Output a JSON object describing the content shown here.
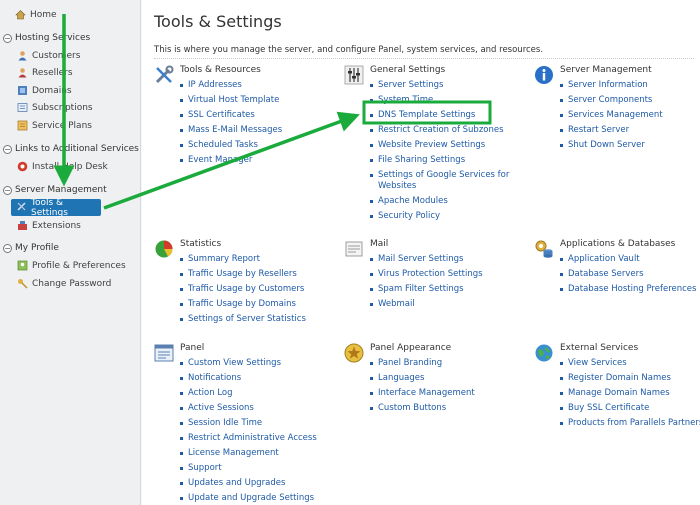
{
  "sidebar": {
    "home": "Home",
    "hosting_services": {
      "title": "Hosting Services",
      "items": [
        "Customers",
        "Resellers",
        "Domains",
        "Subscriptions",
        "Service Plans"
      ]
    },
    "links": {
      "title": "Links to Additional Services",
      "items": [
        "Install Help Desk"
      ]
    },
    "server_management": {
      "title": "Server Management",
      "items": [
        "Tools & Settings",
        "Extensions"
      ]
    },
    "my_profile": {
      "title": "My Profile",
      "items": [
        "Profile & Preferences",
        "Change Password"
      ]
    }
  },
  "main": {
    "title": "Tools & Settings",
    "description": "This is where you manage the server, and configure Panel, system services, and resources.",
    "groups": {
      "tools": {
        "title": "Tools & Resources",
        "items": [
          "IP Addresses",
          "Virtual Host Template",
          "SSL Certificates",
          "Mass E-Mail Messages",
          "Scheduled Tasks",
          "Event Manager"
        ]
      },
      "general": {
        "title": "General Settings",
        "items": [
          "Server Settings",
          "System Time",
          "DNS Template Settings",
          "Restrict Creation of Subzones",
          "Website Preview Settings",
          "File Sharing Settings",
          "Settings of Google Services for Websites",
          "Apache Modules",
          "Security Policy"
        ]
      },
      "server": {
        "title": "Server Management",
        "items": [
          "Server Information",
          "Server Components",
          "Services Management",
          "Restart Server",
          "Shut Down Server"
        ]
      },
      "statistics": {
        "title": "Statistics",
        "items": [
          "Summary Report",
          "Traffic Usage by Resellers",
          "Traffic Usage by Customers",
          "Traffic Usage by Domains",
          "Settings of Server Statistics"
        ]
      },
      "mail": {
        "title": "Mail",
        "items": [
          "Mail Server Settings",
          "Virus Protection Settings",
          "Spam Filter Settings",
          "Webmail"
        ]
      },
      "apps": {
        "title": "Applications & Databases",
        "items": [
          "Application Vault",
          "Database Servers",
          "Database Hosting Preferences"
        ]
      },
      "panel": {
        "title": "Panel",
        "items": [
          "Custom View Settings",
          "Notifications",
          "Action Log",
          "Active Sessions",
          "Session Idle Time",
          "Restrict Administrative Access",
          "License Management",
          "Support",
          "Updates and Upgrades",
          "Update and Upgrade Settings"
        ]
      },
      "appearance": {
        "title": "Panel Appearance",
        "items": [
          "Panel Branding",
          "Languages",
          "Interface Management",
          "Custom Buttons"
        ]
      },
      "external": {
        "title": "External Services",
        "items": [
          "View Services",
          "Register Domain Names",
          "Manage Domain Names",
          "Buy SSL Certificate",
          "Products from Parallels Partners"
        ]
      }
    }
  },
  "colors": {
    "link": "#1e5aa6",
    "active_item": "#1f75b3",
    "annotation": "#1aab3c"
  }
}
